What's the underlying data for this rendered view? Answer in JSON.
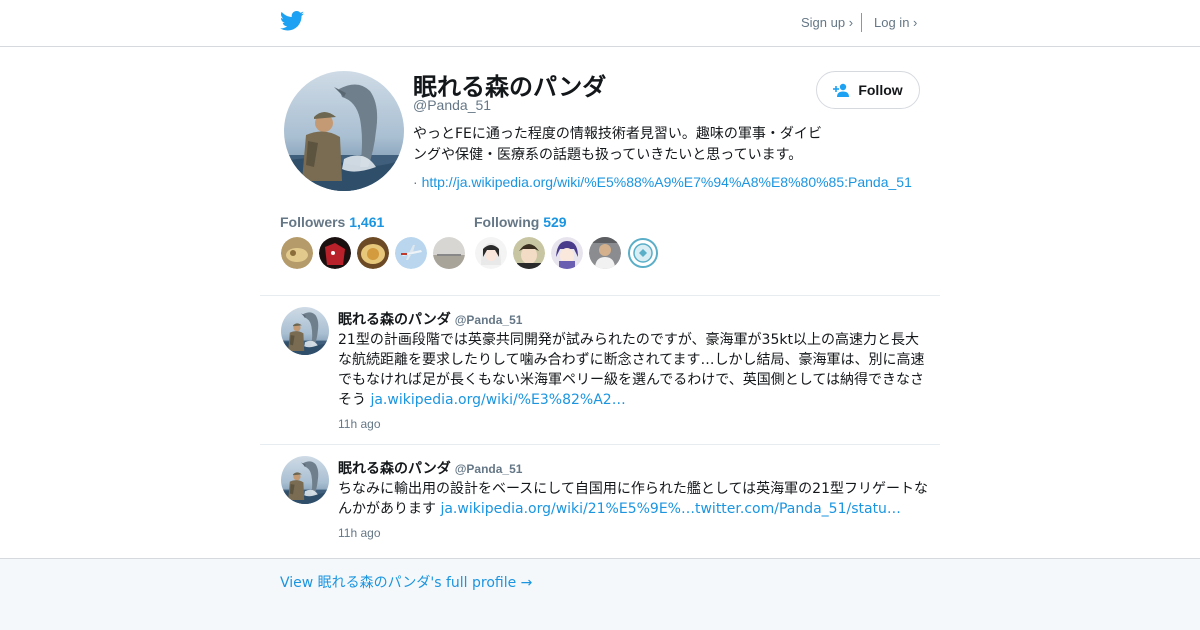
{
  "topbar": {
    "logo_icon": "twitter-bird-icon",
    "signup_label": "Sign up ›",
    "login_label": "Log in ›"
  },
  "profile": {
    "name": "眠れる森のパンダ",
    "handle": "@Panda_51",
    "bio": "やっとFEに通った程度の情報技術者見習い。趣味の軍事・ダイビングや保健・医療系の話題も扱っていきたいと思っています。",
    "url_prefix": "·",
    "url": "http://ja.wikipedia.org/wiki/%E5%88%A9%E7%94%A8%E8%80%85:Panda_51",
    "follow_label": "Follow",
    "follow_icon": "add-person-icon"
  },
  "stats": {
    "followers_label": "Followers",
    "followers_count": "1,461",
    "following_label": "Following",
    "following_count": "529"
  },
  "tweets": [
    {
      "name": "眠れる森のパンダ",
      "handle": "@Panda_51",
      "text": "21型の計画段階では英豪共同開発が試みられたのですが、豪海軍が35kt以上の高速力と長大な航続距離を要求したりして噛み合わずに断念されてます…しかし結局、豪海軍は、別に高速でもなければ足が長くもない米海軍ペリー級を選んでるわけで、英国側としては納得できなさそう",
      "link": "ja.wikipedia.org/wiki/%E3%82%A2…",
      "link2": "",
      "time": "11h ago"
    },
    {
      "name": "眠れる森のパンダ",
      "handle": "@Panda_51",
      "text": "ちなみに輸出用の設計をベースにして自国用に作られた艦としては英海軍の21型フリゲートなんかがあります",
      "link": "ja.wikipedia.org/wiki/21%E5%9E%…",
      "link2": "twitter.com/Panda_51/statu…",
      "time": "11h ago"
    }
  ],
  "footer": {
    "full_profile_label": "View 眠れる森のパンダ's full profile →"
  },
  "colors": {
    "accent": "#1b95e0",
    "twitter_blue": "#1da1f2",
    "muted": "#657786",
    "footer_bg": "#f5f8fa"
  }
}
